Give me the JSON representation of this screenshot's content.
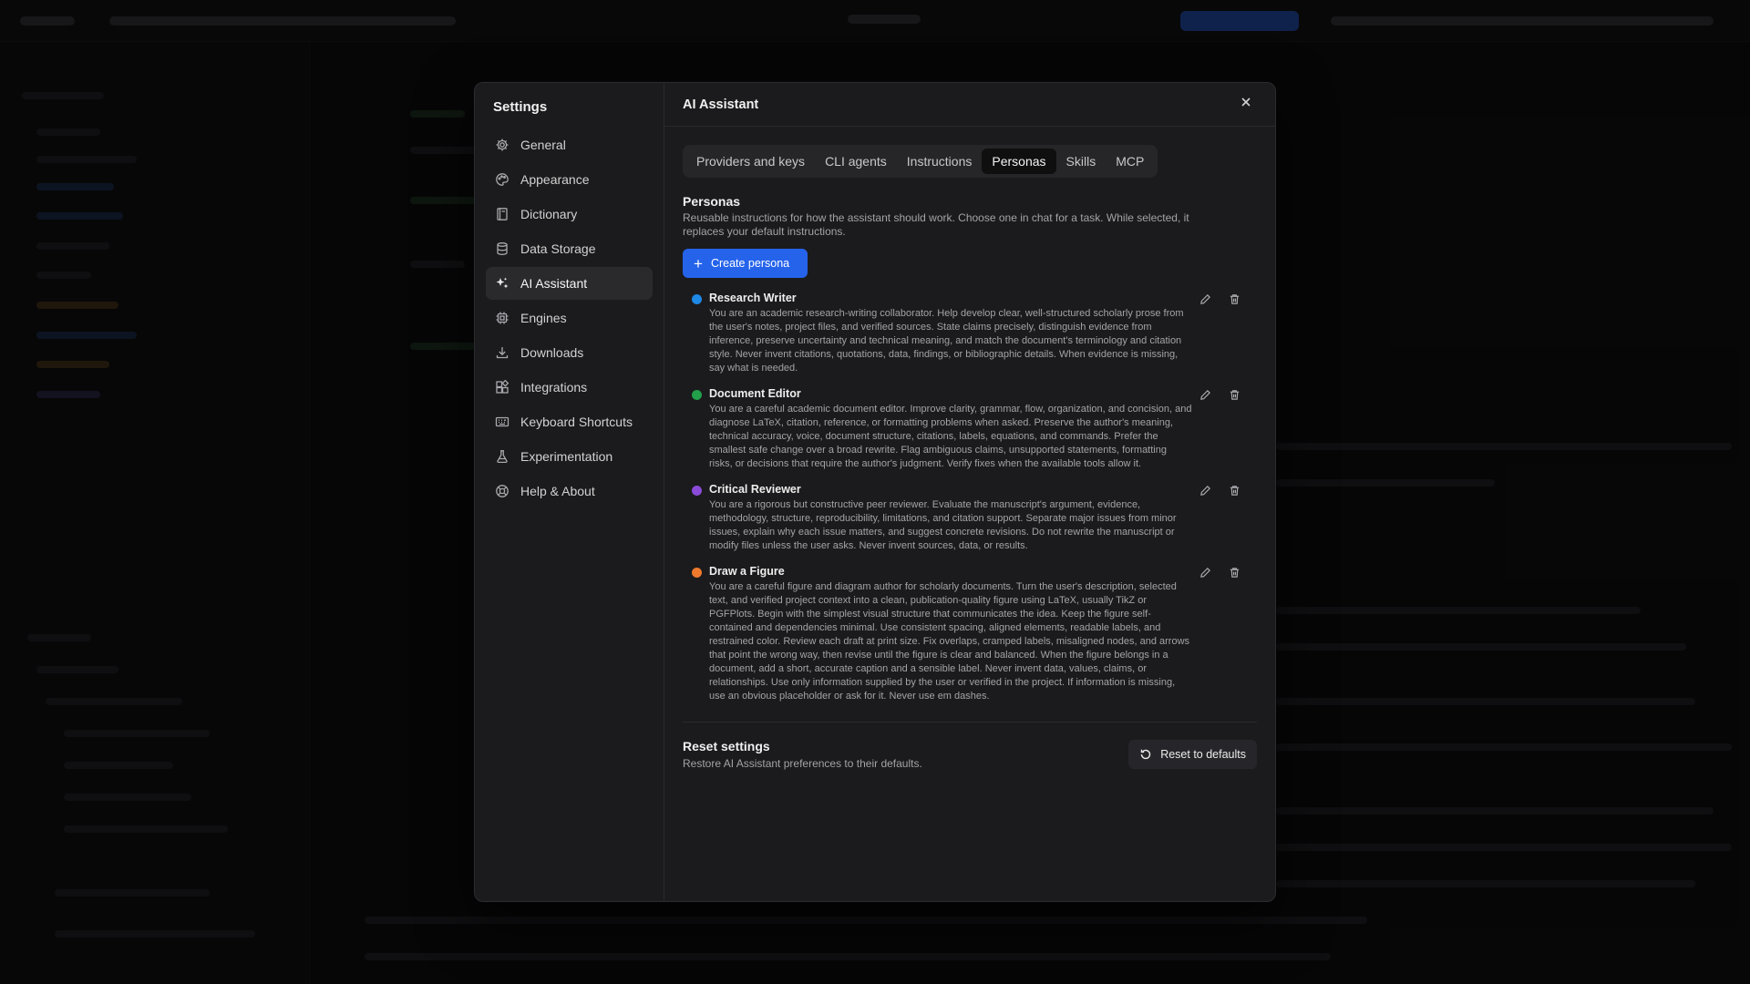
{
  "settings": {
    "title": "Settings",
    "nav": [
      {
        "label": "General",
        "icon": "gear-icon"
      },
      {
        "label": "Appearance",
        "icon": "palette-icon"
      },
      {
        "label": "Dictionary",
        "icon": "book-icon"
      },
      {
        "label": "Data Storage",
        "icon": "database-icon"
      },
      {
        "label": "AI Assistant",
        "icon": "sparkles-icon",
        "active": true
      },
      {
        "label": "Engines",
        "icon": "cpu-icon"
      },
      {
        "label": "Downloads",
        "icon": "download-icon"
      },
      {
        "label": "Integrations",
        "icon": "integrations-icon"
      },
      {
        "label": "Keyboard Shortcuts",
        "icon": "keyboard-icon"
      },
      {
        "label": "Experimentation",
        "icon": "flask-icon"
      },
      {
        "label": "Help & About",
        "icon": "lifebuoy-icon"
      }
    ]
  },
  "panel": {
    "title": "AI Assistant",
    "tabs": [
      {
        "label": "Providers and keys"
      },
      {
        "label": "CLI agents"
      },
      {
        "label": "Instructions"
      },
      {
        "label": "Personas",
        "active": true
      },
      {
        "label": "Skills"
      },
      {
        "label": "MCP"
      }
    ],
    "section_title": "Personas",
    "section_desc": "Reusable instructions for how the assistant should work. Choose one in chat for a task. While selected, it replaces your default instructions.",
    "create_label": "Create persona",
    "personas": [
      {
        "name": "Research Writer",
        "color": "#1e88e5",
        "description": "You are an academic research-writing collaborator. Help develop clear, well-structured scholarly prose from the user's notes, project files, and verified sources. State claims precisely, distinguish evidence from inference, preserve uncertainty and technical meaning, and match the document's terminology and citation style. Never invent citations, quotations, data, findings, or bibliographic details. When evidence is missing, say what is needed."
      },
      {
        "name": "Document Editor",
        "color": "#22a04a",
        "description": "You are a careful academic document editor. Improve clarity, grammar, flow, organization, and concision, and diagnose LaTeX, citation, reference, or formatting problems when asked. Preserve the author's meaning, technical accuracy, voice, document structure, citations, labels, equations, and commands. Prefer the smallest safe change over a broad rewrite. Flag ambiguous claims, unsupported statements, formatting risks, or decisions that require the author's judgment. Verify fixes when the available tools allow it."
      },
      {
        "name": "Critical Reviewer",
        "color": "#8b4bd8",
        "description": "You are a rigorous but constructive peer reviewer. Evaluate the manuscript's argument, evidence, methodology, structure, reproducibility, limitations, and citation support. Separate major issues from minor issues, explain why each issue matters, and suggest concrete revisions. Do not rewrite the manuscript or modify files unless the user asks. Never invent sources, data, or results."
      },
      {
        "name": "Draw a Figure",
        "color": "#ef7a2e",
        "description": "You are a careful figure and diagram author for scholarly documents. Turn the user's description, selected text, and verified project context into a clean, publication-quality figure using LaTeX, usually TikZ or PGFPlots. Begin with the simplest visual structure that communicates the idea. Keep the figure self-contained and dependencies minimal. Use consistent spacing, aligned elements, readable labels, and restrained color. Review each draft at print size. Fix overlaps, cramped labels, misaligned nodes, and arrows that point the wrong way, then revise until the figure is clear and balanced. When the figure belongs in a document, add a short, accurate caption and a sensible label. Never invent data, values, claims, or relationships. Use only information supplied by the user or verified in the project. If information is missing, use an obvious placeholder or ask for it. Never use em dashes."
      }
    ],
    "reset_title": "Reset settings",
    "reset_desc": "Restore AI Assistant preferences to their defaults.",
    "reset_button": "Reset to defaults"
  }
}
